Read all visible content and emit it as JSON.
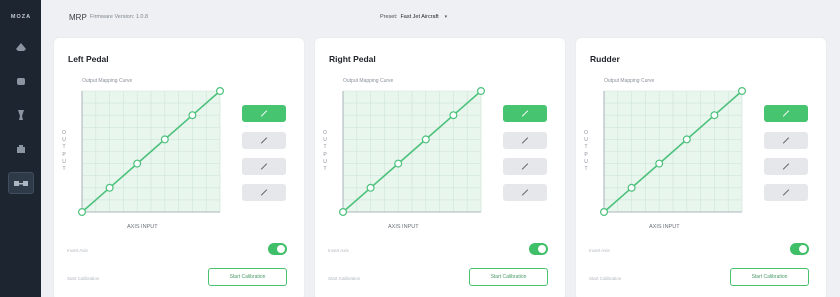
{
  "sidebar": {
    "logo": "MOZA",
    "items": [
      {
        "icon": "wheelbase-icon"
      },
      {
        "icon": "steering-wheel-icon"
      },
      {
        "icon": "pedals-icon"
      },
      {
        "icon": "dashboard-icon"
      },
      {
        "icon": "rudder-pedals-icon",
        "active": true
      }
    ]
  },
  "header": {
    "app_name": "MRP",
    "firmware": "Firmware Version: 1.0.8",
    "preset_label": "Preset:",
    "preset_value": "Fast Jet Aircraft"
  },
  "colors": {
    "accent": "#46c46f",
    "curve": "#4cc17c",
    "grid_fill": "#e8f6ee",
    "sidebar": "#1d2531"
  },
  "cards": [
    {
      "title": "Left Pedal",
      "curve_label": "Output Mapping Curve",
      "y_axis_label": "OUTPUT",
      "x_axis_label": "AXIS INPUT",
      "active_preset": 0,
      "invert_label": "Invert Axis",
      "invert_on": true,
      "calibration_label": "Start Calibration",
      "calibration_button": "Start Calibration"
    },
    {
      "title": "Right Pedal",
      "curve_label": "Output Mapping Curve",
      "y_axis_label": "OUTPUT",
      "x_axis_label": "AXIS INPUT",
      "active_preset": 0,
      "invert_label": "Invert Axis",
      "invert_on": true,
      "calibration_label": "Start Calibration",
      "calibration_button": "Start Calibration"
    },
    {
      "title": "Rudder",
      "curve_label": "Output Mapping Curve",
      "y_axis_label": "OUTPUT",
      "x_axis_label": "AXIS INPUT",
      "active_preset": 0,
      "invert_label": "Invert Axis",
      "invert_on": true,
      "calibration_label": "Start Calibration",
      "calibration_button": "Start Calibration"
    }
  ],
  "chart_data": {
    "type": "line",
    "x": [
      0,
      20,
      40,
      60,
      80,
      100
    ],
    "y": [
      0,
      20,
      40,
      60,
      80,
      100
    ],
    "xlim": [
      0,
      100
    ],
    "ylim": [
      0,
      100
    ],
    "grid": true
  }
}
